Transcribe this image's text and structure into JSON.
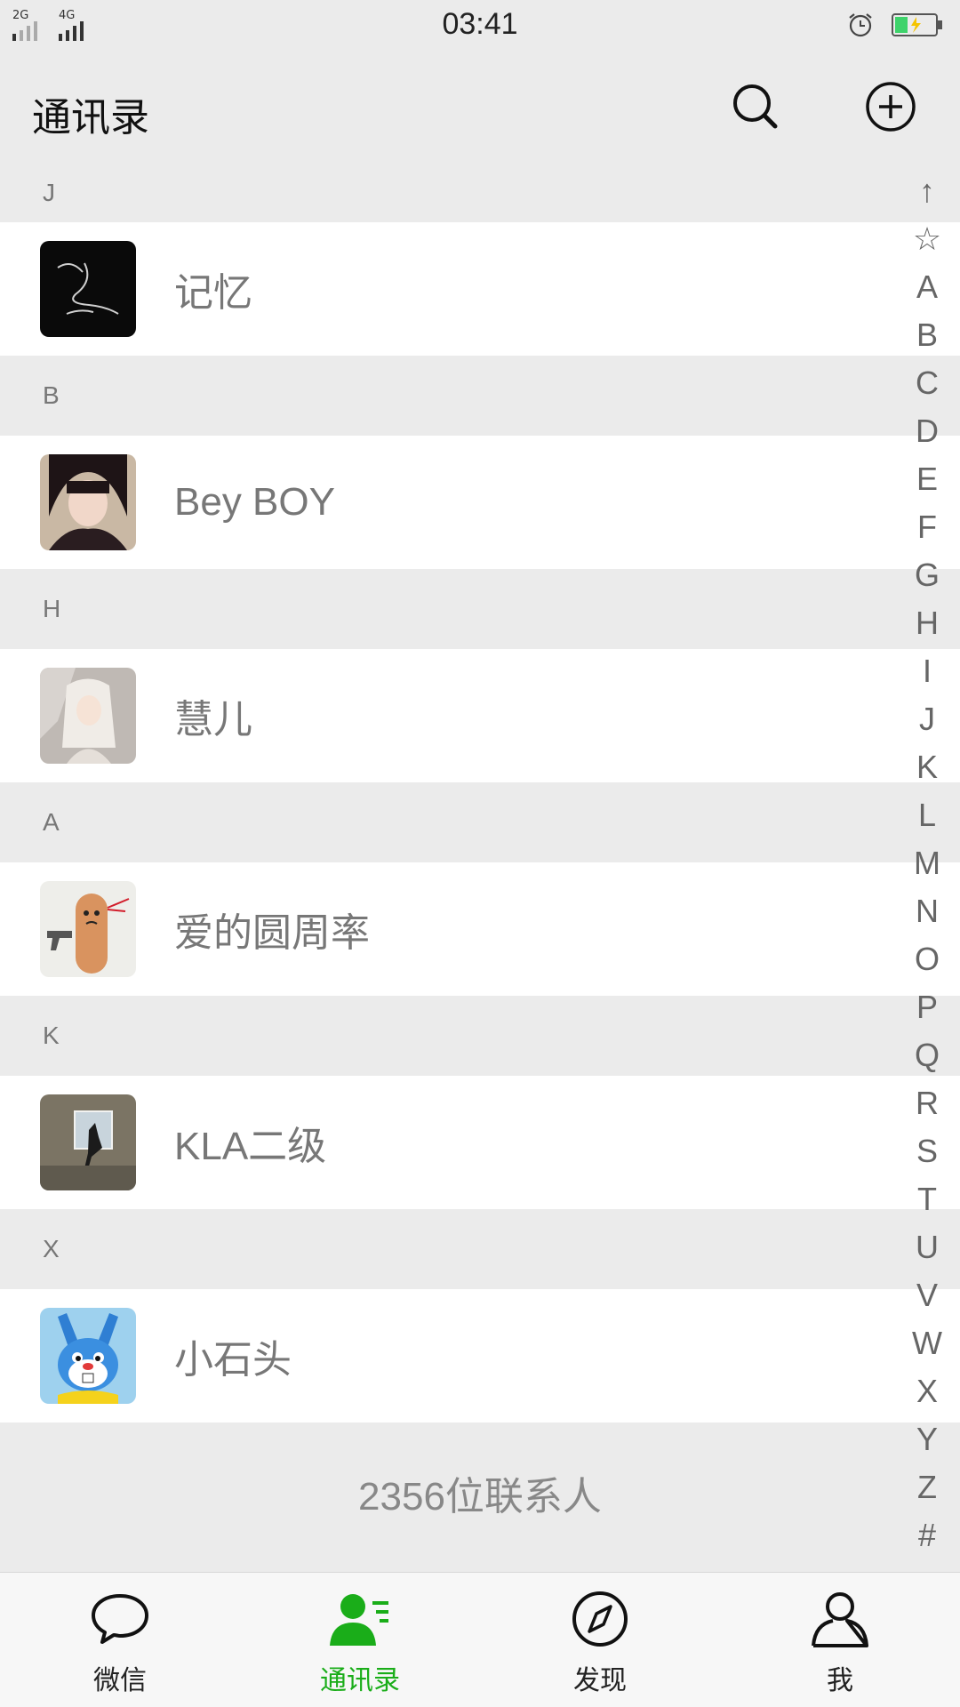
{
  "status_bar": {
    "network_1": "2G",
    "network_2": "4G",
    "time": "03:41",
    "battery_color": "#3ed36b"
  },
  "header": {
    "title": "通讯录",
    "search_icon": "search-icon",
    "add_icon": "add-circle-icon"
  },
  "sections": [
    {
      "letter": "J",
      "contact": "记忆",
      "avatar": "dark-signature"
    },
    {
      "letter": "B",
      "contact": "Bey BOY",
      "avatar": "portrait-girl"
    },
    {
      "letter": "H",
      "contact": "慧儿",
      "avatar": "portrait-fantasy"
    },
    {
      "letter": "A",
      "contact": "爱的圆周率",
      "avatar": "finger-face"
    },
    {
      "letter": "K",
      "contact": "KLA二级",
      "avatar": "window-photo"
    },
    {
      "letter": "X",
      "contact": "小石头",
      "avatar": "blue-rabbit"
    }
  ],
  "footer": {
    "contact_count": "2356位联系人"
  },
  "index_bar": [
    "↑",
    "☆",
    "A",
    "B",
    "C",
    "D",
    "E",
    "F",
    "G",
    "H",
    "I",
    "J",
    "K",
    "L",
    "M",
    "N",
    "O",
    "P",
    "Q",
    "R",
    "S",
    "T",
    "U",
    "V",
    "W",
    "X",
    "Y",
    "Z",
    "#"
  ],
  "tabs": [
    {
      "label": "微信",
      "icon": "chat-bubble-icon",
      "active": false
    },
    {
      "label": "通讯录",
      "icon": "contacts-icon",
      "active": true
    },
    {
      "label": "发现",
      "icon": "compass-icon",
      "active": false
    },
    {
      "label": "我",
      "icon": "person-icon",
      "active": false
    }
  ],
  "colors": {
    "accent": "#1aad19",
    "background": "#ebebeb",
    "row": "#ffffff"
  }
}
